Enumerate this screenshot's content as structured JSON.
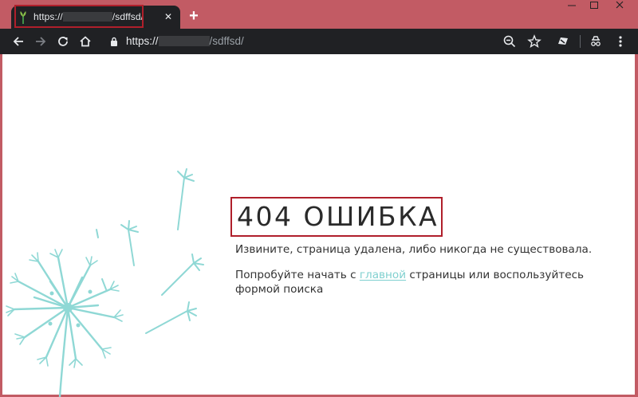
{
  "browser": {
    "tab": {
      "title_prefix": "https://",
      "title_suffix": "/sdffsd/",
      "close_icon": "close-icon"
    },
    "new_tab_label": "+",
    "address_bar": {
      "prefix": "https://",
      "suffix": "/sdffsd/"
    },
    "icons": [
      "back-arrow-icon",
      "forward-arrow-icon",
      "reload-icon",
      "home-icon",
      "lock-icon",
      "zoom-icon",
      "star-icon",
      "extension-icon",
      "menu-icon",
      "incognito-icon"
    ],
    "frame_color": "#c25b64",
    "toolbar_color": "#202124"
  },
  "page": {
    "title": "404 ОШИБКА",
    "message": "Извините, страница удалена, либо никогда не существовала.",
    "suggestion_before": "Попробуйте начать с ",
    "home_link": "главной",
    "suggestion_after": " страницы или воспользуйтесь формой поиска",
    "accent_color": "#7fd0cf",
    "highlight_color": "#b01f2b"
  }
}
